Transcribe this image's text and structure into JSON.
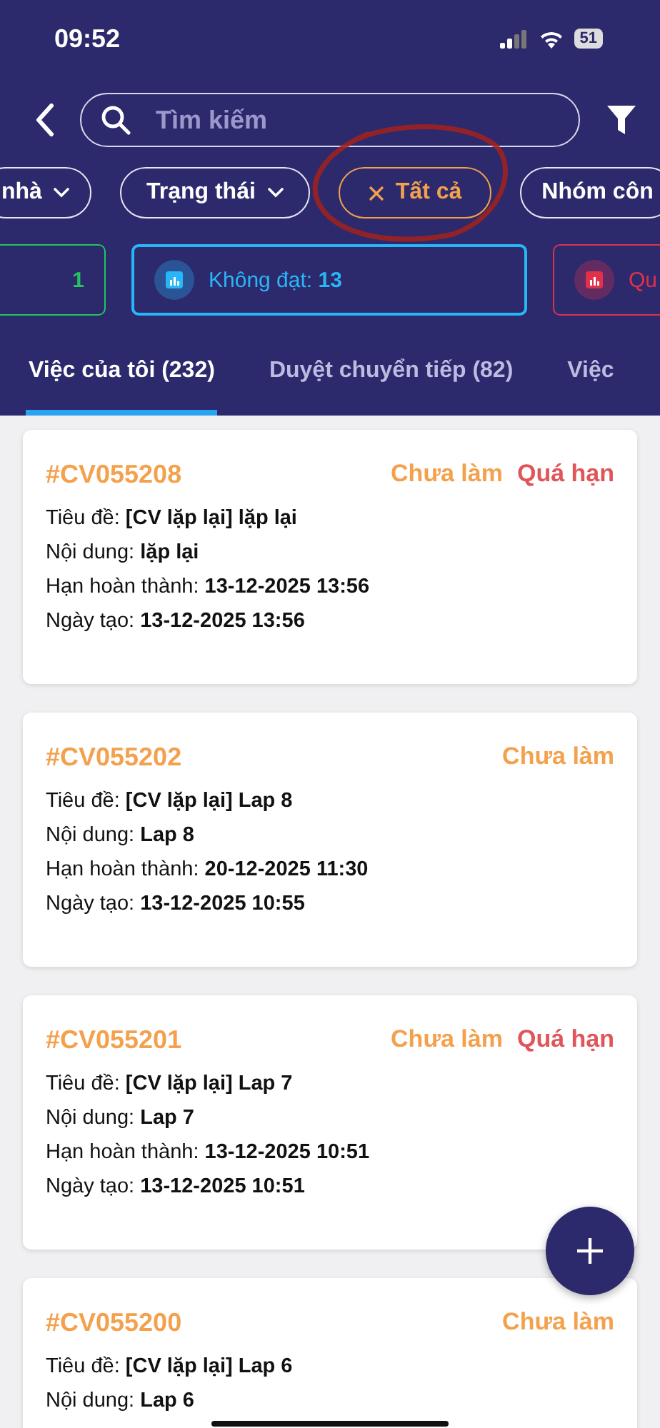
{
  "status_bar": {
    "time": "09:52",
    "battery": "51"
  },
  "search": {
    "placeholder": "Tìm kiếm"
  },
  "filter_chips": [
    {
      "label": "nhà",
      "kind": "dropdown"
    },
    {
      "label": "Trạng thái",
      "kind": "dropdown"
    },
    {
      "label": "Tất cả",
      "kind": "clearable"
    },
    {
      "label": "Nhóm côn",
      "kind": "plain"
    }
  ],
  "stat_cards": [
    {
      "value": "1",
      "color": "#22c55e"
    },
    {
      "label": "Không đạt:",
      "value": "13",
      "color": "#29b6f6"
    },
    {
      "label": "Qu",
      "color": "#e0314b"
    }
  ],
  "tabs": [
    {
      "label": "Việc của tôi (232)",
      "selected": true
    },
    {
      "label": "Duyệt chuyển tiếp (82)",
      "selected": false
    },
    {
      "label": "Việc",
      "selected": false
    }
  ],
  "tasks": [
    {
      "code": "#CV055208",
      "status": "Chưa làm",
      "overdue": "Quá hạn",
      "fields": [
        {
          "label": "Tiêu đề:",
          "value": "[CV lặp lại] lặp lại"
        },
        {
          "label": "Nội dung:",
          "value": "lặp lại"
        },
        {
          "label": "Hạn hoàn thành:",
          "value": "13-12-2025 13:56"
        },
        {
          "label": "Ngày tạo:",
          "value": "13-12-2025 13:56"
        }
      ]
    },
    {
      "code": "#CV055202",
      "status": "Chưa làm",
      "fields": [
        {
          "label": "Tiêu đề:",
          "value": "[CV lặp lại] Lap 8"
        },
        {
          "label": "Nội dung:",
          "value": "Lap 8"
        },
        {
          "label": "Hạn hoàn thành:",
          "value": "20-12-2025 11:30"
        },
        {
          "label": "Ngày tạo:",
          "value": "13-12-2025 10:55"
        }
      ]
    },
    {
      "code": "#CV055201",
      "status": "Chưa làm",
      "overdue": "Quá hạn",
      "fields": [
        {
          "label": "Tiêu đề:",
          "value": "[CV lặp lại] Lap 7"
        },
        {
          "label": "Nội dung:",
          "value": "Lap 7"
        },
        {
          "label": "Hạn hoàn thành:",
          "value": "13-12-2025 10:51"
        },
        {
          "label": "Ngày tạo:",
          "value": "13-12-2025 10:51"
        }
      ]
    },
    {
      "code": "#CV055200",
      "status": "Chưa làm",
      "fields": [
        {
          "label": "Tiêu đề:",
          "value": "[CV lặp lại] Lap 6"
        },
        {
          "label": "Nội dung:",
          "value": "Lap 6"
        }
      ]
    }
  ]
}
